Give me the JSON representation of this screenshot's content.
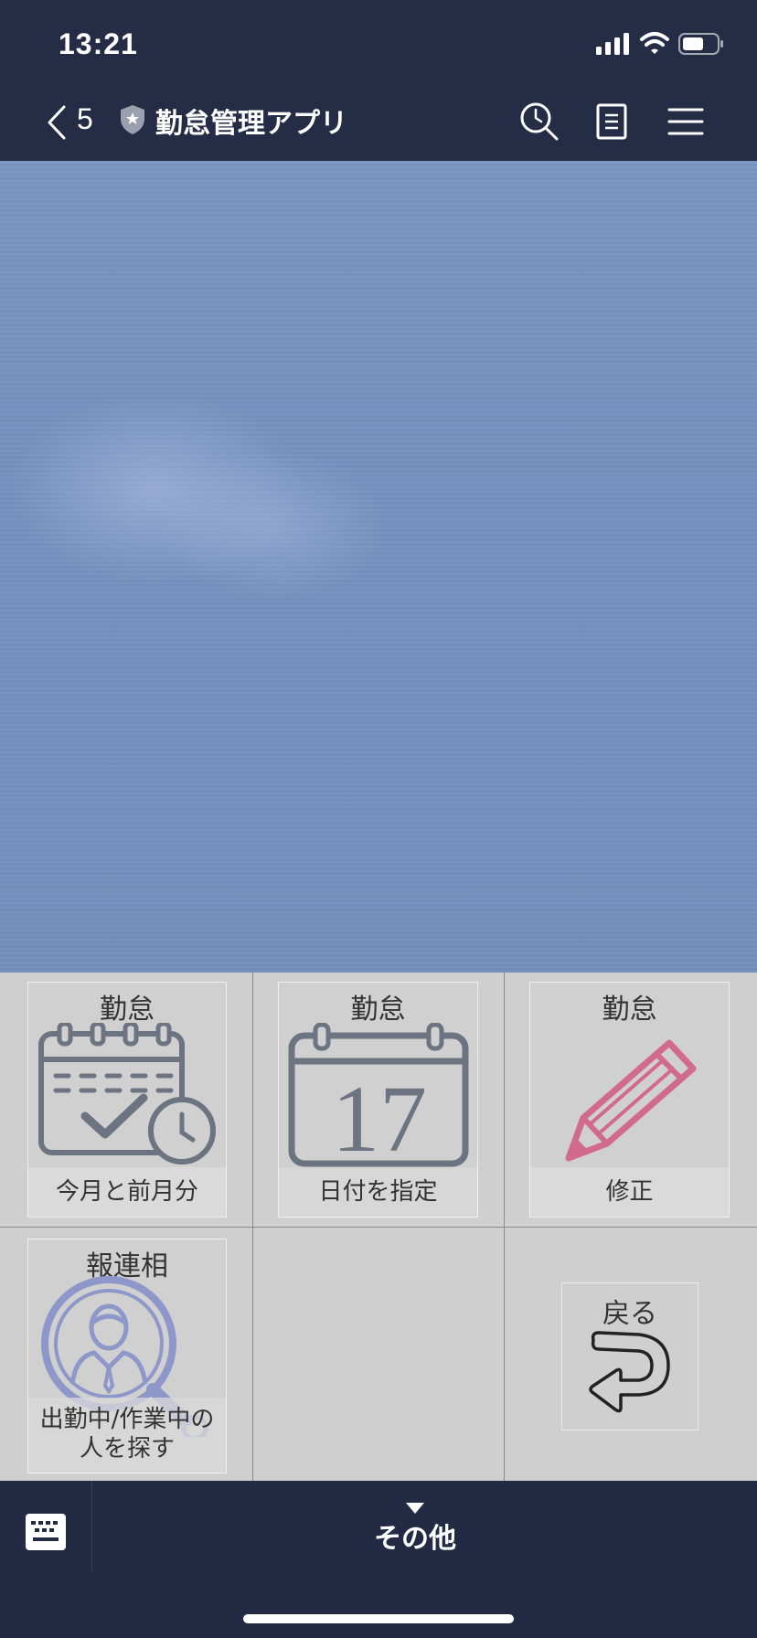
{
  "status_bar": {
    "time": "13:21"
  },
  "nav": {
    "back_count": "5",
    "title": "勤怠管理アプリ"
  },
  "rich_menu": {
    "tiles": [
      {
        "header": "勤怠",
        "label": "今月と前月分",
        "icon": "calendar-check-icon"
      },
      {
        "header": "勤怠",
        "label": "日付を指定",
        "icon": "calendar-date-icon",
        "date_number": "17"
      },
      {
        "header": "勤怠",
        "label": "修正",
        "icon": "pencil-icon"
      },
      {
        "header": "報連相",
        "label_line1": "出勤中/作業中の",
        "label_line2": "人を探す",
        "icon": "person-search-icon"
      },
      {
        "header": "戻る",
        "icon": "return-arrow-icon"
      }
    ]
  },
  "bottom_bar": {
    "menu_label": "その他"
  },
  "colors": {
    "bar_bg": "#242c46",
    "content_bg": "#7892c0",
    "menu_bg": "#cfcfcf",
    "pencil": "#d16a8c",
    "search_icon": "#8e97c9",
    "icon_gray": "#6b7480"
  }
}
